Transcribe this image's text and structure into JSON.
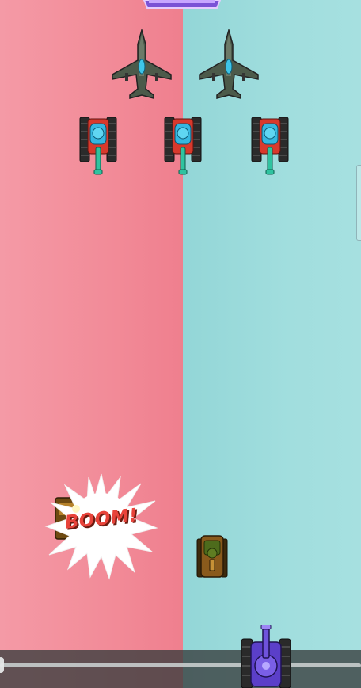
{
  "scene": {
    "left_lane_color": "#f28c9a",
    "right_lane_color": "#9fdcdc",
    "divider_color": "#ffffff"
  },
  "hud": {
    "banner_colors": [
      "#8a63e0",
      "#d9b8ff"
    ],
    "progress": 0
  },
  "enemies": {
    "planes": [
      "enemy-jet",
      "enemy-jet"
    ],
    "turret_tanks": [
      "armored-turret-tank",
      "armored-turret-tank",
      "armored-turret-tank"
    ]
  },
  "effects": {
    "explosion_text": "BOOM!"
  },
  "units": {
    "ally_tank": "olive-tank",
    "player_tank": "purple-cannon-tank"
  }
}
